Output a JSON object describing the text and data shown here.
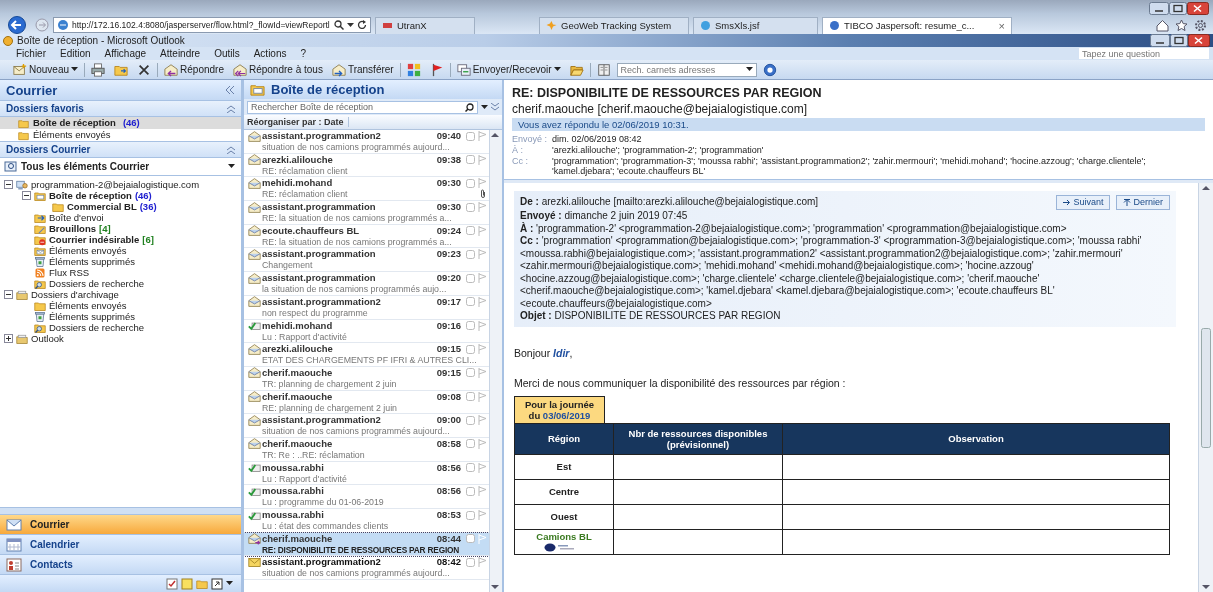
{
  "browser": {
    "address": "http://172.16.102.4:8080/jasperserver/flow.html?_flowId=viewReportl",
    "tabs": [
      {
        "label": "UtranX",
        "selected": false,
        "closable": false
      },
      {
        "label": "GeoWeb Tracking System",
        "selected": false,
        "closable": false
      },
      {
        "label": "SmsXls.jsf",
        "selected": false,
        "closable": false
      },
      {
        "label": "TIBCO Jaspersoft: resume_c...",
        "selected": true,
        "closable": true
      }
    ],
    "close_glyph": "×"
  },
  "window": {
    "title": "Boîte de réception - Microsoft Outlook"
  },
  "menu": [
    "Fichier",
    "Edition",
    "Affichage",
    "Atteindre",
    "Outils",
    "Actions",
    "?"
  ],
  "question_field": {
    "placeholder": "Tapez une question"
  },
  "toolbar": [
    {
      "kind": "new",
      "label": "Nouveau",
      "dropdown": true
    },
    {
      "kind": "print"
    },
    {
      "kind": "move"
    },
    {
      "kind": "delete"
    },
    {
      "kind": "reply",
      "label": "Répondre",
      "dropdown": false
    },
    {
      "kind": "reply-all",
      "label": "Répondre à tous",
      "dropdown": false
    },
    {
      "kind": "forward",
      "label": "Transférer",
      "dropdown": false
    },
    {
      "kind": "categories"
    },
    {
      "kind": "flag"
    },
    {
      "kind": "send-receive",
      "label": "Envoyer/Recevoir",
      "dropdown": true
    },
    {
      "kind": "open-folder"
    },
    {
      "kind": "address-book"
    },
    {
      "kind": "search-field",
      "placeholder": "Rech. carnets adresses",
      "dropdown": true
    },
    {
      "kind": "help"
    }
  ],
  "nav": {
    "title": "Courrier",
    "favorites_title": "Dossiers favoris",
    "favorites": [
      {
        "label": "Boîte de réception",
        "count": "(46)",
        "color": "#2020d0",
        "bold": true,
        "selected": true
      },
      {
        "label": "Éléments envoyés",
        "bold": false,
        "selected": false
      }
    ],
    "folders_title": "Dossiers Courrier",
    "all_items": "Tous les éléments Courrier",
    "tree": [
      {
        "label": "programmation-2@bejaialogistique.com",
        "kind": "account",
        "bold": false,
        "expanded": true,
        "children": [
          {
            "label": "Boîte de réception",
            "count": "(46)",
            "color": "#2020d0",
            "kind": "inbox",
            "bold": true,
            "expanded": true,
            "children": [
              {
                "label": "Commercial BL",
                "count": "(36)",
                "color": "#2020d0",
                "kind": "folder",
                "bold": true
              }
            ]
          },
          {
            "label": "Boîte d'envoi",
            "kind": "outbox",
            "bold": false
          },
          {
            "label": "Brouillons",
            "count": "[4]",
            "color": "#208020",
            "kind": "drafts",
            "bold": true
          },
          {
            "label": "Courrier indésirable",
            "count": "[6]",
            "color": "#208020",
            "kind": "junk",
            "bold": true
          },
          {
            "label": "Éléments envoyés",
            "kind": "sent",
            "bold": false
          },
          {
            "label": "Éléments supprimés",
            "kind": "deleted",
            "bold": false
          },
          {
            "label": "Flux RSS",
            "kind": "rss",
            "bold": false
          },
          {
            "label": "Dossiers de recherche",
            "kind": "search",
            "bold": false
          }
        ]
      },
      {
        "label": "Dossiers d'archivage",
        "kind": "archive",
        "bold": false,
        "expanded": true,
        "children": [
          {
            "label": "Éléments envoyés",
            "kind": "folder",
            "bold": false
          },
          {
            "label": "Éléments supprimés",
            "kind": "deleted",
            "bold": false
          },
          {
            "label": "Dossiers de recherche",
            "kind": "search",
            "bold": false
          }
        ]
      },
      {
        "label": "Outlook",
        "kind": "archive",
        "bold": false,
        "expanded": false
      }
    ],
    "buttons": [
      {
        "label": "Courrier",
        "kind": "mail",
        "selected": true
      },
      {
        "label": "Calendrier",
        "kind": "calendar",
        "selected": false
      },
      {
        "label": "Contacts",
        "kind": "contacts",
        "selected": false
      }
    ]
  },
  "list": {
    "title": "Boîte de réception",
    "search": {
      "placeholder": "Rechercher Boîte de réception"
    },
    "sort": "Réorganiser par : Date",
    "messages": [
      {
        "sender": "assistant.programmation2",
        "time": "09:40",
        "subject": "situation de nos camions programmés aujourd...",
        "kind": "read",
        "attachment": false,
        "selected": false
      },
      {
        "sender": "arezki.alilouche",
        "time": "09:38",
        "subject": "RE: réclamation client",
        "kind": "read",
        "attachment": false,
        "selected": false
      },
      {
        "sender": "mehidi.mohand",
        "time": "09:30",
        "subject": "RE: réclamation client",
        "kind": "read",
        "attachment": true,
        "selected": false
      },
      {
        "sender": "assistant.programmation",
        "time": "09:30",
        "subject": "RE: la situation de nos camions programmés a...",
        "kind": "read",
        "attachment": false,
        "selected": false
      },
      {
        "sender": "ecoute.chauffeurs BL",
        "time": "09:24",
        "subject": "RE: la situation de nos camions programmés a...",
        "kind": "read",
        "attachment": false,
        "selected": false
      },
      {
        "sender": "assistant.programmation",
        "time": "09:23",
        "subject": "Changement",
        "kind": "read",
        "attachment": false,
        "selected": false
      },
      {
        "sender": "assistant.programmation",
        "time": "09:20",
        "subject": "la situation de nos camions programmés aujo...",
        "kind": "read",
        "attachment": false,
        "selected": false
      },
      {
        "sender": "assistant.programmation2",
        "time": "09:17",
        "subject": "non respect du programme",
        "kind": "read",
        "attachment": false,
        "selected": false
      },
      {
        "sender": "mehidi.mohand",
        "time": "09:16",
        "subject": "Lu : Rapport d'activité",
        "kind": "receipt",
        "attachment": false,
        "selected": false
      },
      {
        "sender": "arezki.alilouche",
        "time": "09:15",
        "subject": "ETAT DES CHARGEMENTS PF IFRI & AUTRES CLI...",
        "kind": "read",
        "attachment": false,
        "selected": false
      },
      {
        "sender": "cherif.maouche",
        "time": "09:15",
        "subject": "TR: planning de chargement 2 juin",
        "kind": "read",
        "attachment": false,
        "selected": false
      },
      {
        "sender": "cherif.maouche",
        "time": "09:08",
        "subject": "RE: planning de chargement 2 juin",
        "kind": "read",
        "attachment": false,
        "selected": false
      },
      {
        "sender": "assistant.programmation2",
        "time": "09:00",
        "subject": "situation de nos camions programmés aujourd...",
        "kind": "read",
        "attachment": false,
        "selected": false
      },
      {
        "sender": "cherif.maouche",
        "time": "08:58",
        "subject": "TR: Re : ..RE: réclamation",
        "kind": "read",
        "attachment": false,
        "selected": false
      },
      {
        "sender": "moussa.rabhi",
        "time": "08:56",
        "subject": "Lu : Rapport d'activité",
        "kind": "receipt",
        "attachment": false,
        "selected": false
      },
      {
        "sender": "moussa.rabhi",
        "time": "08:56",
        "subject": "Lu : programme du 01-06-2019",
        "kind": "receipt",
        "attachment": false,
        "selected": false
      },
      {
        "sender": "moussa.rabhi",
        "time": "08:53",
        "subject": "Lu : état des commandes clients",
        "kind": "receipt",
        "attachment": false,
        "selected": false
      },
      {
        "sender": "cherif.maouche",
        "time": "08:44",
        "subject": "RE: DISPONIBILITE DE RESSOURCES PAR REGION",
        "kind": "replied",
        "attachment": false,
        "selected": true
      },
      {
        "sender": "assistant.programmation2",
        "time": "08:42",
        "subject": "situation de nos camions programmés aujourd...",
        "kind": "unread",
        "attachment": false,
        "selected": false
      }
    ]
  },
  "reading": {
    "subject": "RE: DISPONIBILITE DE RESSOURCES PAR REGION",
    "from": "cherif.maouche [cherif.maouche@bejaialogistique.com]",
    "info": "Vous avez répondu le 02/06/2019 10:31.",
    "headers": [
      {
        "label": "Envoyé :",
        "value": "dim. 02/06/2019 08:42"
      },
      {
        "label": "À :",
        "value": "'arezki.alilouche'; 'programmation-2'; 'programmation'"
      },
      {
        "label": "Cc :",
        "value": "'programmation'; 'programmation-3'; 'moussa rabhi'; 'assistant.programmation2'; 'zahir.mermouri'; 'mehidi.mohand'; 'hocine.azzoug'; 'charge.clientele'; 'kamel.djebara'; 'ecoute.chauffeurs BL'"
      }
    ],
    "quote_header": [
      "**De :** arezki.alilouche [mailto:arezki.alilouche@bejaialogistique.com]",
      "**Envoyé :** dimanche 2 juin 2019 07:45",
      "**À :** 'programmation-2' <programmation-2@bejaialogistique.com>; 'programmation' <programmation@bejaialogistique.com>",
      "**Cc :** 'programmation' <programmation@bejaialogistique.com>; 'programmation-3' <programmation-3@bejaialogistique.com>; 'moussa rabhi' <moussa.rabhi@bejaialogistique.com>; 'assistant.programmation2' <assistant.programmation2@bejaialogistique.com>; 'zahir.mermouri' <zahir.mermouri@bejaialogistique.com>; 'mehidi.mohand' <mehidi.mohand@bejaialogistique.com>; 'hocine.azzoug' <hocine.azzoug@bejaialogistique.com>; 'charge.clientele' <charge.clientele@bejaialogistique.com>; 'cherif.maouche' <cherif.maouche@bejaialogistique.com>; 'kamel.djebara' <kamel.djebara@bejaialogistique.com>; 'ecoute.chauffeurs BL' <ecoute.chauffeurs@bejaialogistique.com>",
      "**Objet :** DISPONIBILITE DE RESSOURCES PAR REGION"
    ],
    "nav_buttons": [
      {
        "label": "Suivant",
        "kind": "next"
      },
      {
        "label": "Dernier",
        "kind": "last"
      }
    ],
    "greeting": "Bonjour *Idir*,",
    "paragraph": "Merci de nous communiquer la disponibilité des ressources par région :",
    "table": {
      "day_label": "Pour la journée",
      "day_prefix": "du",
      "date": "03/06/2019",
      "columns": [
        "Région",
        "Nbr de ressources disponibles (prévisionnel)",
        "Observation"
      ],
      "rows": [
        {
          "label": "Est",
          "kind": "text"
        },
        {
          "label": "Centre",
          "kind": "text"
        },
        {
          "label": "Ouest",
          "kind": "text"
        },
        {
          "label": "Camions BL",
          "kind": "logo"
        }
      ]
    }
  }
}
